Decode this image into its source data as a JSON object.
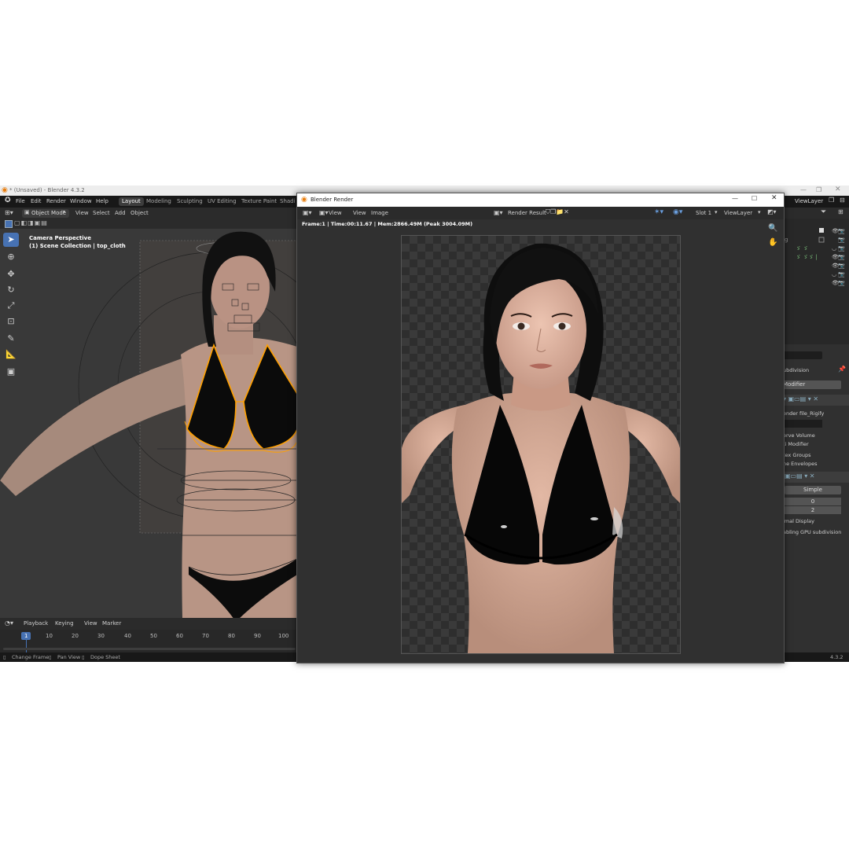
{
  "app": {
    "title": "* (Unsaved) - Blender 4.3.2",
    "version": "4.3.2"
  },
  "menus": [
    "File",
    "Edit",
    "Render",
    "Window",
    "Help"
  ],
  "workspaces": [
    "Layout",
    "Modeling",
    "Sculpting",
    "UV Editing",
    "Texture Paint",
    "Shadi"
  ],
  "viewport": {
    "mode": "Object Mode",
    "menus": [
      "View",
      "Select",
      "Add",
      "Object"
    ],
    "overlay_title": "Camera Perspective",
    "overlay_subtitle": "(1) Scene Collection | top_cloth"
  },
  "timeline": {
    "menus": [
      "Playback",
      "Keying",
      "View",
      "Marker"
    ],
    "current_frame": "1",
    "ticks": [
      "10",
      "20",
      "30",
      "40",
      "50",
      "60",
      "70",
      "80",
      "90",
      "100"
    ]
  },
  "statusbar": {
    "items": [
      "Change Frame",
      "Pan View",
      "Dope Sheet"
    ],
    "version": "4.3.2"
  },
  "render_window": {
    "title": "Blender Render",
    "menus": [
      "View",
      "View",
      "Image"
    ],
    "result": "Render Result",
    "slot": "Slot 1",
    "view_layer": "ViewLayer",
    "info": "Frame:1 | Time:00:11.67 | Mem:2866.49M (Peak 3004.09M)"
  },
  "right_panel": {
    "view_layer": "ViewLayer",
    "rows": [
      "ubdivision",
      "Modifier",
      "ender file_Rigify",
      "erve Volume",
      "ti Modifier",
      "tex Groups",
      "ne Envelopes",
      "Simple",
      "0",
      "2",
      "imal Display",
      "abling GPU subdivision"
    ]
  },
  "colors": {
    "accent": "#4772b3",
    "selection": "#ff9a1f"
  }
}
